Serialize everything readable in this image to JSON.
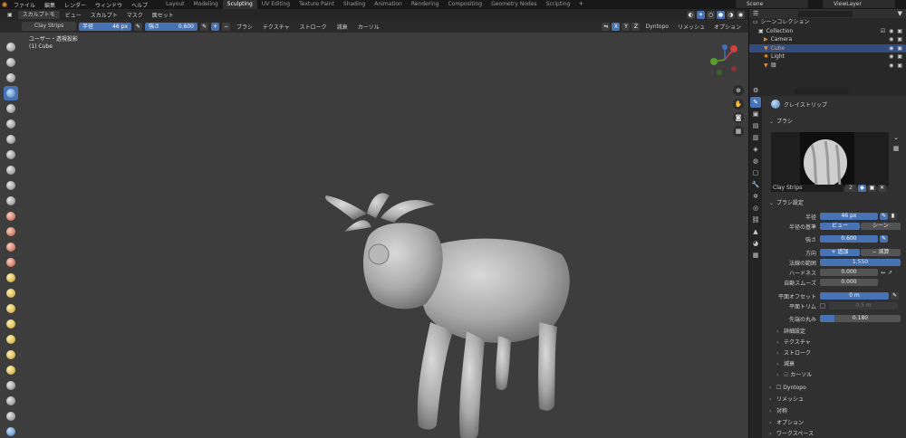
{
  "topbar": {
    "menus": [
      "ファイル",
      "編集",
      "レンダー",
      "ウィンドウ",
      "ヘルプ"
    ],
    "workspaces": [
      "Layout",
      "Modeling",
      "Sculpting",
      "UV Editing",
      "Texture Paint",
      "Shading",
      "Animation",
      "Rendering",
      "Compositing",
      "Geometry Nodes",
      "Scripting"
    ],
    "active_workspace": "Sculpting",
    "add_tab": "+",
    "scene": "Scene",
    "view_layer": "ViewLayer"
  },
  "header1": {
    "mode": "スカルプトモ",
    "menus": [
      "ビュー",
      "スカルプト",
      "マスク",
      "面セット"
    ]
  },
  "header2": {
    "brush": "Clay Strips",
    "radius_label": "半径",
    "radius_value": "46 px",
    "strength_label": "強さ",
    "strength_value": "0.600",
    "menus": [
      "ブラシ",
      "テクスチャ",
      "ストローク",
      "減衰",
      "カーソル"
    ],
    "axes": [
      "X",
      "Y",
      "Z"
    ],
    "dyntopo": "Dyntopo",
    "remesh": "リメッシュ",
    "options": "オプション"
  },
  "viewport": {
    "view_label": "ユーザー・透視投影",
    "object_label": "(1) Cube"
  },
  "outliner": {
    "header": "シーンコレクション",
    "rows": [
      {
        "label": "Collection",
        "icon": "collection-icon"
      },
      {
        "label": "Camera",
        "icon": "camera-icon"
      },
      {
        "label": "Cube",
        "icon": "mesh-icon",
        "selected": true
      },
      {
        "label": "Light",
        "icon": "light-icon"
      },
      {
        "label": "頭",
        "icon": "mesh-icon"
      }
    ]
  },
  "properties": {
    "tool_title": "クレイストリップ",
    "brush_section": "ブラシ",
    "brush_name": "Clay Strips",
    "brush_users": "2",
    "settings_section": "ブラシ設定",
    "radius_label": "半径",
    "radius_value": "46 px",
    "radius_unit_label": "半径の基準",
    "radius_unit_view": "ビュー",
    "radius_unit_scene": "シーン",
    "strength_label": "強さ",
    "strength_value": "0.600",
    "direction_label": "方向",
    "direction_add": "追加",
    "direction_sub": "減算",
    "normal_radius_label": "法線の範囲",
    "normal_radius_value": "1.550",
    "hardness_label": "ハードネス",
    "hardness_value": "0.000",
    "autosmooth_label": "自動スムーズ",
    "autosmooth_value": "0.000",
    "plane_offset_label": "平面オフセット",
    "plane_offset_value": "0 m",
    "plane_trim_label": "平面トリム",
    "plane_trim_value": "0.5 m",
    "tip_round_label": "先端の丸み",
    "tip_round_value": "0.180",
    "subsections": [
      "詳細設定",
      "テクスチャ",
      "ストローク",
      "減衰",
      "カーソル"
    ],
    "dyntopo": "Dyntopo",
    "remesh": "リメッシュ",
    "symmetry": "対称",
    "options": "オプション",
    "workspace": "ワークスペース"
  }
}
